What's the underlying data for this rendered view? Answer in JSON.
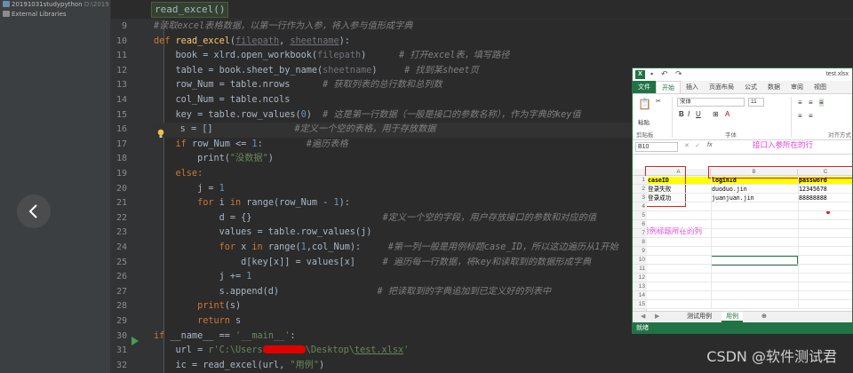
{
  "project": {
    "items": [
      {
        "name": "20191031studypython",
        "path": "D:\\2019"
      },
      {
        "name": "External Libraries",
        "path": ""
      }
    ]
  },
  "editor": {
    "breadcrumb": "read_excel()",
    "line_numbers": [
      "9",
      "10",
      "11",
      "12",
      "13",
      "14",
      "15",
      "16",
      "17",
      "18",
      "19",
      "20",
      "21",
      "22",
      "23",
      "24",
      "25",
      "26",
      "27",
      "28",
      "29",
      "30",
      "31",
      "32"
    ]
  },
  "code": {
    "l9_comment": "#读取excel表格数据，以第一行作为入参，将入参与值形成字典",
    "l10_def": "def",
    "l10_fname": "read_excel",
    "l10_open": "(",
    "l10_p1": "filepath",
    "l10_comma": ", ",
    "l10_p2": "sheetname",
    "l10_close": "):",
    "l11_code": "    book = xlrd.open_workbook(",
    "l11_arg": "filepath",
    "l11_close": ")",
    "l11_comment": "# 打开excel表，填写路径",
    "l12_code": "    table = book.sheet_by_name(",
    "l12_arg": "sheetname",
    "l12_close": ")",
    "l12_comment": "# 找到某sheet页",
    "l13_code": "    row_Num = table.nrows",
    "l13_comment": "# 获取列表的总行数和总列数",
    "l14_code": "    col_Num = table.ncols",
    "l15_code": "    key = table.row_values(",
    "l15_num": "0",
    "l15_close": ")",
    "l15_comment": "# 这是第一行数据（一般是接口的参数名称），作为字典的key值",
    "l16_code": "    s = []",
    "l16_comment": "#定义一个空的表格，用于存放数据",
    "l17_kw": "    if",
    "l17_code": " row_Num <= ",
    "l17_num": "1",
    "l17_colon": ":",
    "l17_comment": "#遍历表格",
    "l18_code": "        print(",
    "l18_str": "\"没数据\"",
    "l18_close": ")",
    "l19_kw": "    else:",
    "l20_code": "        j = ",
    "l20_num": "1",
    "l21_kw1": "        for",
    "l21_code1": " i ",
    "l21_kw2": "in",
    "l21_code2": " range(row_Num - ",
    "l21_num": "1",
    "l21_close": "):",
    "l22_code": "            d = {}",
    "l22_comment": "#定义一个空的字段，用户存放接口的参数和对应的值",
    "l23_code": "            values = table.row_values(j)",
    "l24_kw1": "            for",
    "l24_code1": " x ",
    "l24_kw2": "in",
    "l24_code2": " range(",
    "l24_num": "1",
    "l24_code3": ",col_Num):",
    "l24_comment": "#第一列一般是用例标题case_ID，所以这边遍历从1开始",
    "l25_code": "                d[key[x]] = values[x]",
    "l25_comment": "# 遍历每一行数据，将key和读取到的数据形成字典",
    "l26_code": "            j += ",
    "l26_num": "1",
    "l27_code": "            s.append(d)",
    "l27_comment": "# 把读取到的字典追加到已定义好的列表中",
    "l28_kw": "        print",
    "l28_code": "(s)",
    "l29_kw": "        return",
    "l29_code": " s",
    "l30_kw": "if",
    "l30_code": " __name__ == ",
    "l30_str": "'__main__'",
    "l30_colon": ":",
    "l31_code": "    url = ",
    "l31_str1": "r'C:\\Users",
    "l31_str2": "\\Desktop\\",
    "l31_file": "test.xlsx",
    "l31_str3": "'",
    "l32_code": "    ic = read_excel(url, ",
    "l32_str": "\"用例\"",
    "l32_close": ")"
  },
  "excel": {
    "title": "test.xlsx",
    "logo": "X",
    "tabs": [
      "文件",
      "开始",
      "插入",
      "页面布局",
      "公式",
      "数据",
      "审阅",
      "视图"
    ],
    "ribbon": {
      "paste": "粘贴",
      "clipboard_label": "剪贴板",
      "font_name": "宋体",
      "font_size": "11",
      "font_label": "字体",
      "align_label": "对齐方式",
      "bold": "B",
      "italic": "I",
      "underline": "U"
    },
    "name_box": "B10",
    "fx": "fx",
    "columns": [
      "A",
      "B",
      "C"
    ],
    "rows": [
      "1",
      "2",
      "3",
      "4",
      "5",
      "6",
      "7",
      "8",
      "9",
      "10",
      "11",
      "12",
      "13",
      "14",
      "15"
    ],
    "cells": {
      "a1": "caseID",
      "b1": "loginId",
      "c1": "password",
      "a2": "登录失败",
      "b2": "duoduo.jin",
      "c2": "12345678",
      "a3": "登录成功",
      "b3": "juanjuan.jin",
      "c3": "88888888"
    },
    "sheets": [
      "测试用例",
      "用例"
    ],
    "add_sheet": "⊕",
    "status": "就绪"
  },
  "annotations": {
    "params_row": "接口入参所在的行",
    "case_col": "用例标题所在的列"
  },
  "watermark": "CSDN @软件测试君",
  "colors": {
    "excel_green": "#217346",
    "annotation_box": "#e02020",
    "annotation_text": "#e040e0",
    "header_fill": "#ffff00"
  }
}
